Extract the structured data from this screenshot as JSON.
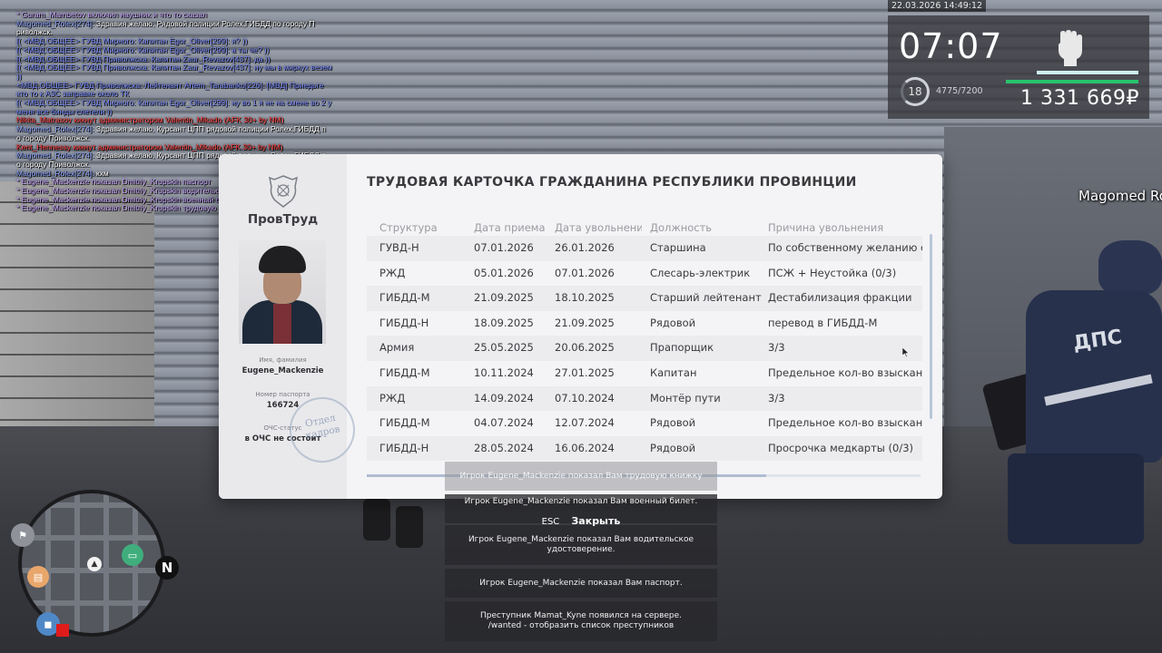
{
  "chat": [
    {
      "nick": "* Guram_Mambetov включил наушник и что то сказал",
      "msg": "",
      "nick_color": "#c9a6ff"
    },
    {
      "nick": "Magomed_Rolex[274]:",
      "msg": "Здравия желаю, Рядовой полиции Ролех,ГИБДД по городу П",
      "nick_color": "#8da5ff"
    },
    {
      "nick": "",
      "msg": "риволжск.",
      "nick_color": "#8da5ff"
    },
    {
      "nick": "[( <МВД.ОБЩЕЕ> ГУВД Мирного: Капитан Egor_Oliver[299]: я? ))",
      "msg": "",
      "nick_color": "#7a8cff"
    },
    {
      "nick": "[( <МВД.ОБЩЕЕ> ГУВД Мирного: Капитан Egor_Oliver[299]: а ты че? ))",
      "msg": "",
      "nick_color": "#7a8cff"
    },
    {
      "nick": "[( <МВД.ОБЩЕЕ> ГУВД Приволжска: Капитан Zaur_Revazov[437]: да ))",
      "msg": "",
      "nick_color": "#7a8cff"
    },
    {
      "nick": "[( <МВД.ОБЩЕЕ> ГУВД Приволжска: Капитан Zaur_Revazov[437]: ну мы в миркух везем",
      "msg": "",
      "nick_color": "#7a8cff"
    },
    {
      "nick": "))",
      "msg": "",
      "nick_color": "#7a8cff"
    },
    {
      "nick": "<МВД.ОБЩЕЕ> ГУВД Приволжска: Лейтенант Artem_Tarabanko[226]: [МВД] Приедьте",
      "msg": "",
      "nick_color": "#7a8cff"
    },
    {
      "nick": "кто то к АЗС заправке около ТК",
      "msg": "",
      "nick_color": "#7a8cff"
    },
    {
      "nick": "[( <МВД.ОБЩЕЕ> ГУВД Мирного: Капитан Egor_Oliver[299]: ну во 1 я не на смене во 2 у",
      "msg": "",
      "nick_color": "#7a8cff"
    },
    {
      "nick": "меня все бинды слетели ))",
      "msg": "",
      "nick_color": "#7a8cff"
    },
    {
      "nick": "Nikita_Matrasov кикнут администратором Valentin_Mikado (AFK 30+ by NM)",
      "msg": "",
      "nick_color": "#ff3b3b"
    },
    {
      "nick": "Magomed_Rolex[274]:",
      "msg": "Здравия желаю, Курсант ЦПП рядовой полиции Ролех,ГИБДД п",
      "nick_color": "#8da5ff"
    },
    {
      "nick": "",
      "msg": "о городу Приволжск.",
      "nick_color": "#8da5ff"
    },
    {
      "nick": "Kent_Hennessy кикнут администратором Valentin_Mikado (AFK 30+ by NM)",
      "msg": "",
      "nick_color": "#ff3b3b"
    },
    {
      "nick": "Magomed_Rolex[274]:",
      "msg": "Здравия желаю, Курсант ЦПП рядовой полиции Ролех,ГИБДД п",
      "nick_color": "#8da5ff"
    },
    {
      "nick": "",
      "msg": "о городу Приволжск.",
      "nick_color": "#8da5ff"
    },
    {
      "nick": "Magomed_Rolex[274]:",
      "msg": "кхм",
      "nick_color": "#8da5ff"
    },
    {
      "nick": "* Eugene_Mackenzie показал Dmitriy_Krupskin паспорт",
      "msg": "",
      "nick_color": "#c9a6ff"
    },
    {
      "nick": "* Eugene_Mackenzie показал Dmitriy_Krupskin водительское удостоверение",
      "msg": "",
      "nick_color": "#c9a6ff"
    },
    {
      "nick": "* Eugene_Mackenzie показал Dmitriy_Krupskin военный билет",
      "msg": "",
      "nick_color": "#c9a6ff"
    },
    {
      "nick": "* Eugene_Mackenzie показал Dmitriy_Krupskin трудовую книжку",
      "msg": "",
      "nick_color": "#c9a6ff"
    }
  ],
  "hud": {
    "datetime": "22.03.2026 14:49:12",
    "time": "07:07",
    "level": "18",
    "exp": "4775/7200",
    "exp_fraction": 0.66,
    "money": "1 331 669₽",
    "colors": {
      "health_bar": "#cfeff0",
      "armor_bar": "#27c46b"
    }
  },
  "player_tag": "Magomed Ro",
  "card": {
    "title": "ТРУДОВАЯ КАРТОЧКА ГРАЖДАНИНА РЕСПУБЛИКИ ПРОВИНЦИИ",
    "org_name": "ПровТруд",
    "name_label": "Имя, фамилия",
    "name_value": "Eugene_Mackenzie",
    "passport_label": "Номер паспорта",
    "passport_value": "166724",
    "status_label": "ОЧС-статус",
    "status_value": "в ОЧС не состоит",
    "stamp_text": [
      "Отдел",
      "кадров"
    ],
    "columns": [
      "Структура",
      "Дата приема",
      "Дата увольнения",
      "Должность",
      "Причина увольнения"
    ],
    "rows": [
      [
        "ГУВД-Н",
        "07.01.2026",
        "26.01.2026",
        "Старшина",
        "По собственному желанию с о"
      ],
      [
        "РЖД",
        "05.01.2026",
        "07.01.2026",
        "Слесарь-электрик",
        "ПСЖ + Неустойка (0/3)"
      ],
      [
        "ГИБДД-М",
        "21.09.2025",
        "18.10.2025",
        "Старший лейтенант",
        "Дестабилизация фракции"
      ],
      [
        "ГИБДД-Н",
        "18.09.2025",
        "21.09.2025",
        "Рядовой",
        "перевод в ГИБДД-М"
      ],
      [
        "Армия",
        "25.05.2025",
        "20.06.2025",
        "Прапорщик",
        "3/3"
      ],
      [
        "ГИБДД-М",
        "10.11.2024",
        "27.01.2025",
        "Капитан",
        "Предельное кол-во взысканий"
      ],
      [
        "РЖД",
        "14.09.2024",
        "07.10.2024",
        "Монтёр пути",
        "3/3"
      ],
      [
        "ГИБДД-М",
        "04.07.2024",
        "12.07.2024",
        "Рядовой",
        "Предельное кол-во взысканий"
      ],
      [
        "ГИБДД-Н",
        "28.05.2024",
        "16.06.2024",
        "Рядовой",
        "Просрочка медкарты (0/3)"
      ]
    ]
  },
  "notifications": [
    {
      "lines": [
        "Игрок Eugene_Mackenzie показал Вам трудовую книжку"
      ]
    },
    {
      "lines": [
        "Игрок Eugene_Mackenzie показал Вам военный билет."
      ]
    },
    {
      "lines": [
        "Игрок Eugene_Mackenzie показал Вам водительское",
        "удостоверение."
      ]
    },
    {
      "lines": [
        "Игрок Eugene_Mackenzie показал Вам паспорт."
      ]
    },
    {
      "lines": [
        "Преступник Mamat_Kyne появился на сервере.",
        "/wanted - отобразить список преступников"
      ]
    }
  ],
  "close": {
    "key": "ESC",
    "label": "Закрыть"
  },
  "minimap": {
    "north": "N"
  }
}
